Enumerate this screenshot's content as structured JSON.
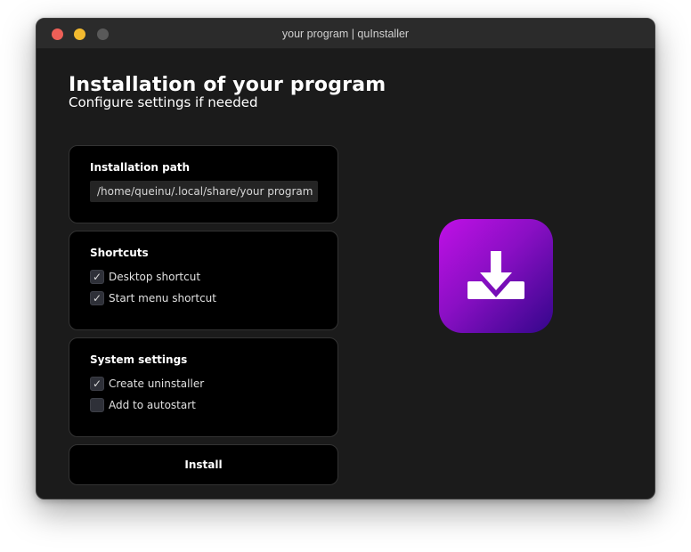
{
  "window": {
    "title": "your program | quInstaller"
  },
  "header": {
    "title": "Installation of your program",
    "subtitle": "Configure settings if needed"
  },
  "installation_path": {
    "label": "Installation path",
    "value": "/home/queinu/.local/share/your program"
  },
  "shortcuts": {
    "label": "Shortcuts",
    "items": [
      {
        "label": "Desktop shortcut",
        "checked": true
      },
      {
        "label": "Start menu shortcut",
        "checked": true
      }
    ]
  },
  "system_settings": {
    "label": "System settings",
    "items": [
      {
        "label": "Create uninstaller",
        "checked": true
      },
      {
        "label": "Add to autostart",
        "checked": false
      }
    ]
  },
  "install_button": {
    "label": "Install"
  },
  "app_icon": {
    "icon": "download-icon",
    "gradient_start": "#c010e6",
    "gradient_end": "#33068a"
  },
  "colors": {
    "window_bg": "#1b1b1b",
    "card_bg": "#000000",
    "close": "#ed5f57",
    "minimize": "#f2b92f",
    "maximize": "#595959"
  }
}
